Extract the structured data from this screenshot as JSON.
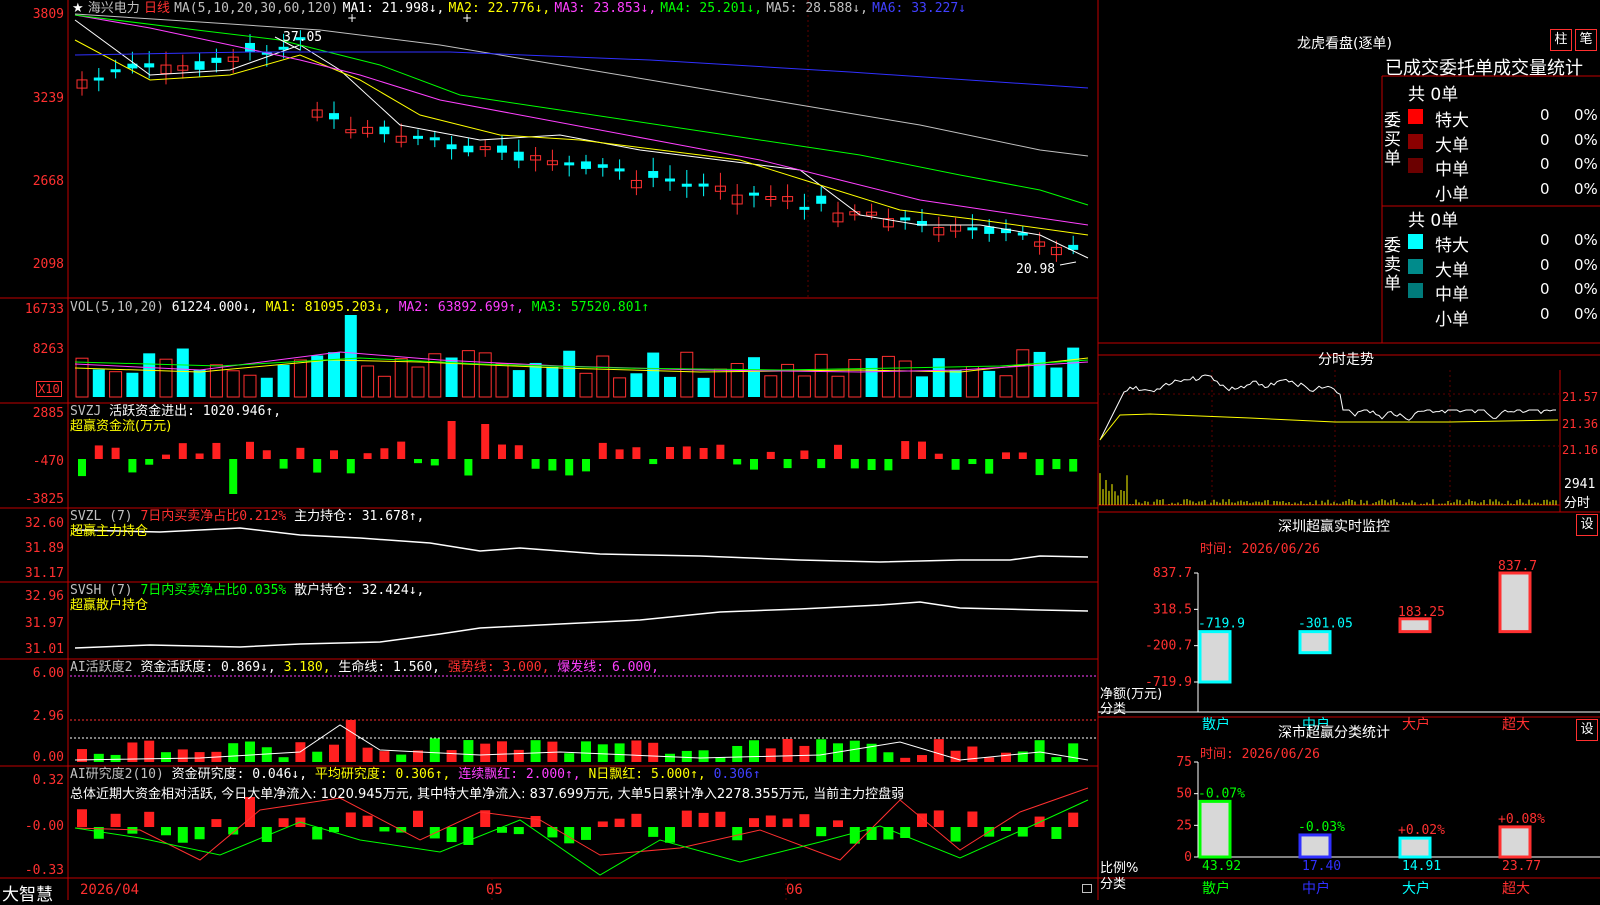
{
  "main": {
    "header": {
      "star": "★",
      "stock_name": "海兴电力",
      "period": "日线",
      "ma_label": "MA(5,10,20,30,60,120)",
      "ma1": "MA1: 21.998↓,",
      "ma2": "MA2: 22.776↓,",
      "ma3": "MA3: 23.853↓,",
      "ma4": "MA4: 25.201↓,",
      "ma5": "MA5: 28.588↓,",
      "ma6": "MA6: 33.227↓"
    },
    "yticks": [
      "3809",
      "3239",
      "2668",
      "2098"
    ],
    "high_label": "37.05",
    "low_label": "20.98"
  },
  "vol": {
    "label": "VOL(5,10,20)",
    "value": "61224.000↓,",
    "ma1": "MA1: 81095.203↓,",
    "ma2": "MA2: 63892.699↑,",
    "ma3": "MA3: 57520.801↑",
    "yticks": [
      "16733",
      "8263"
    ],
    "unit": "X10"
  },
  "svzj": {
    "label": "SVZJ",
    "value": "活跃资金进出: 1020.946↑,",
    "subtitle": "超赢资金流(万元)",
    "yticks": [
      "2885",
      "-470",
      "-3825"
    ]
  },
  "svzl": {
    "label": "SVZL (7)",
    "pct": "7日内买卖净占比0.212%",
    "value": "主力持仓: 31.678↑,",
    "subtitle": "超赢主力持仓",
    "yticks": [
      "32.60",
      "31.89",
      "31.17"
    ]
  },
  "svsh": {
    "label": "SVSH (7)",
    "pct": "7日内买卖净占比0.035%",
    "value": "散户持仓: 32.424↓,",
    "subtitle": "超赢散户持仓",
    "yticks": [
      "32.96",
      "31.97",
      "31.01"
    ]
  },
  "ai1": {
    "label": "AI活跃度2",
    "v1": "资金活跃度: 0.869↓,",
    "v2": "3.180,",
    "v3": "生命线: 1.560,",
    "v4": "强势线: 3.000,",
    "v5": "爆发线: 6.000,",
    "yticks": [
      "6.00",
      "2.96",
      "0.00"
    ]
  },
  "ai2": {
    "label": "AI研究度2(10)",
    "v1": "资金研究度: 0.046↓,",
    "v2": "平均研究度: 0.306↑,",
    "v3": "连续飘红: 2.000↑,",
    "v4": "N日飘红: 5.000↑,",
    "v5": "0.306↑",
    "summary": "总体近期大资金相对活跃, 今日大单净流入: 1020.945万元, 其中特大单净流入: 837.699万元, 大单5日累计净入2278.355万元, 当前主力控盘弱",
    "yticks": [
      "0.32",
      "-0.00",
      "-0.33"
    ]
  },
  "bottom": {
    "brand": "大智慧",
    "dates": [
      "2026/04",
      "05",
      "06"
    ]
  },
  "longhu": {
    "title": "龙虎看盘(逐单)",
    "btn1": "柱",
    "btn2": "笔",
    "tabs": "已成交委托单成交量统计",
    "buy_label": "委买单",
    "sell_label": "委卖单",
    "buy_total": "共 0单",
    "sell_total": "共 0单",
    "buy_rows": [
      {
        "name": "特大",
        "count": "0",
        "pct": "0%",
        "color": "#ff0000"
      },
      {
        "name": "大单",
        "count": "0",
        "pct": "0%",
        "color": "#8b0000"
      },
      {
        "name": "中单",
        "count": "0",
        "pct": "0%",
        "color": "#6b0000"
      },
      {
        "name": "小单",
        "count": "0",
        "pct": "0%",
        "color": "#000000"
      }
    ],
    "sell_rows": [
      {
        "name": "特大",
        "count": "0",
        "pct": "0%",
        "color": "#00ffff"
      },
      {
        "name": "大单",
        "count": "0",
        "pct": "0%",
        "color": "#008b8b"
      },
      {
        "name": "中单",
        "count": "0",
        "pct": "0%",
        "color": "#007b7b"
      },
      {
        "name": "小单",
        "count": "0",
        "pct": "0%",
        "color": "#000000"
      }
    ]
  },
  "intraday": {
    "title": "分时走势",
    "yticks": [
      "21.57",
      "21.36",
      "21.16"
    ],
    "vol_tick": "2941",
    "vol_unit": "分时"
  },
  "monitor": {
    "title": "深圳超赢实时监控",
    "btn": "设",
    "time": "时间: 2026/06/26",
    "yticks": [
      "837.7",
      "318.5",
      "-200.7",
      "-719.9"
    ],
    "ylabel1": "净额(万元)",
    "ylabel2": "分类",
    "categories": [
      "散户",
      "中户",
      "大户",
      "超大"
    ],
    "bar_labels": [
      "-719.9",
      "-301.05",
      "183.25",
      "837.7"
    ]
  },
  "classstat": {
    "title": "深市超赢分类统计",
    "btn": "设",
    "time": "时间: 2026/06/26",
    "yticks": [
      "75",
      "50",
      "25",
      "0"
    ],
    "ylabel1": "比例%",
    "ylabel2": "分类",
    "categories": [
      "散户",
      "中户",
      "大户",
      "超大"
    ],
    "pct_labels": [
      "-0.07%",
      "-0.03%",
      "+0.02%",
      "+0.08%"
    ],
    "bottom_labels": [
      "43.92",
      "17.40",
      "14.91",
      "23.77"
    ]
  },
  "chart_data": [
    {
      "type": "bar",
      "title": "深圳超赢实时监控",
      "categories": [
        "散户",
        "中户",
        "大户",
        "超大"
      ],
      "values": [
        -719.9,
        -301.05,
        183.25,
        837.7
      ],
      "ylabel": "净额(万元)",
      "ylim": [
        -719.9,
        837.7
      ]
    },
    {
      "type": "bar",
      "title": "深市超赢分类统计",
      "categories": [
        "散户",
        "中户",
        "大户",
        "超大"
      ],
      "values": [
        43.92,
        17.4,
        14.91,
        23.77
      ],
      "ylabel": "比例%",
      "ylim": [
        0,
        75
      ]
    }
  ]
}
